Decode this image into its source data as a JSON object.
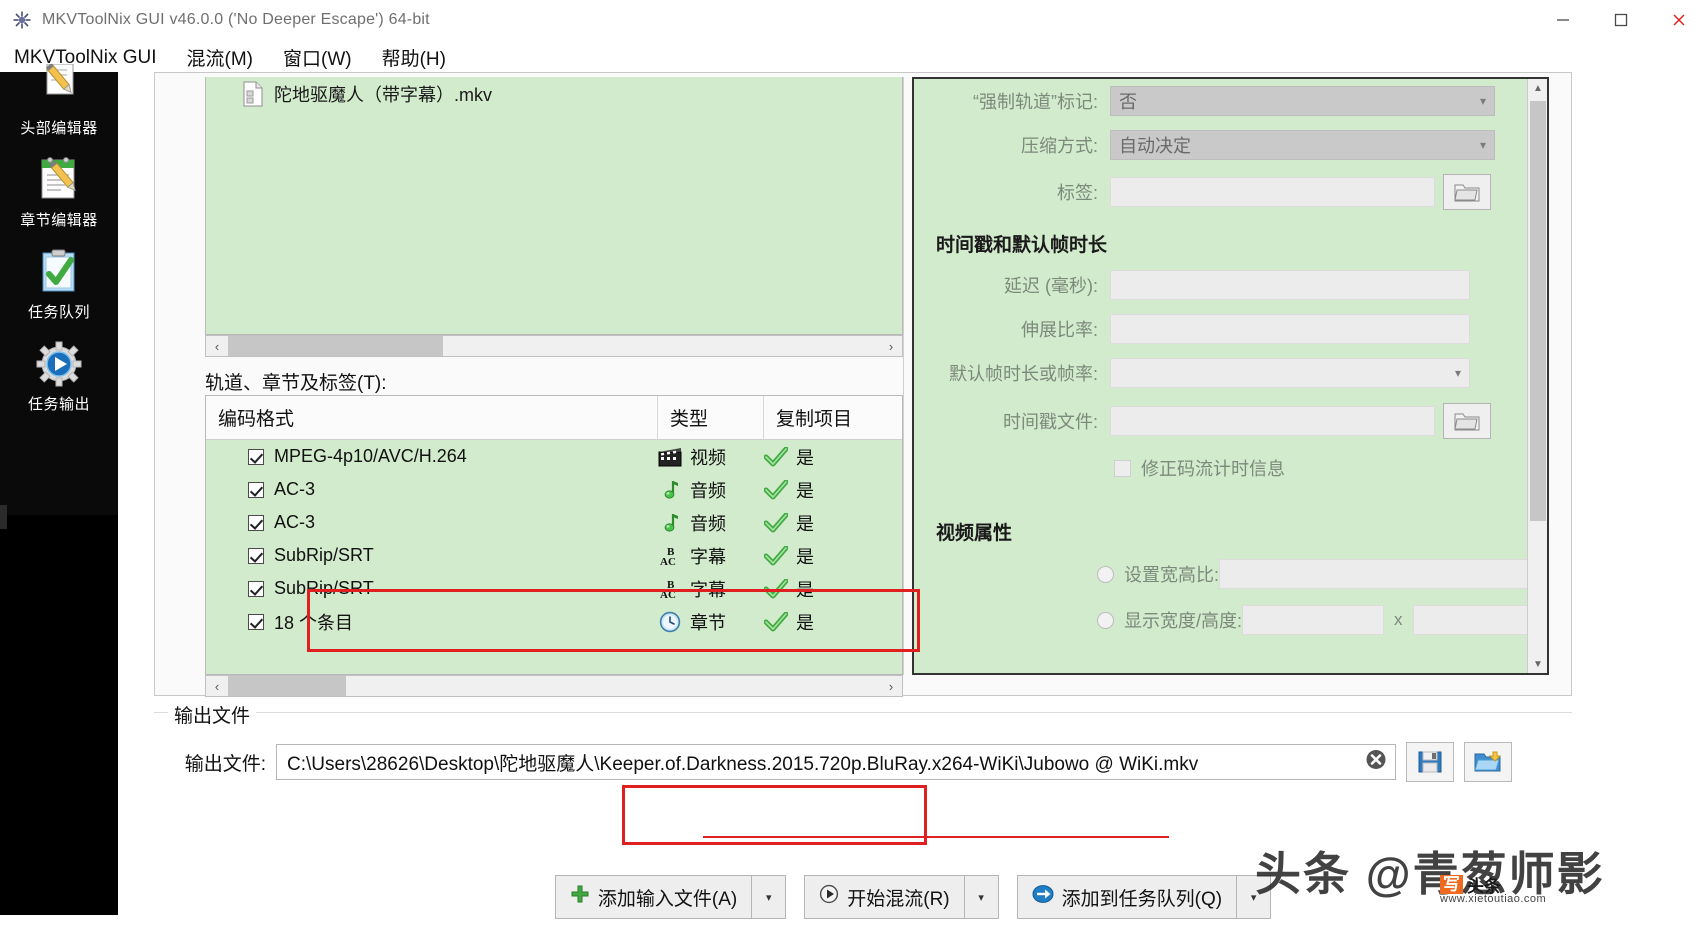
{
  "window": {
    "title": "MKVToolNix GUI v46.0.0 ('No Deeper Escape') 64-bit",
    "app_icon": "mkvtoolnix-icon",
    "minimize_label": "—",
    "maximize_label": "❐",
    "close_label": "✕"
  },
  "menubar": {
    "items": [
      {
        "label": "MKVToolNix GUI",
        "name": "menu-mkvtoolnix-gui"
      },
      {
        "label": "混流(M)",
        "name": "menu-multiplex"
      },
      {
        "label": "窗口(W)",
        "name": "menu-window"
      },
      {
        "label": "帮助(H)",
        "name": "menu-help"
      }
    ]
  },
  "sidebar": {
    "items": [
      {
        "label": "头部编辑器",
        "icon": "header-editor-icon"
      },
      {
        "label": "章节编辑器",
        "icon": "chapter-editor-icon"
      },
      {
        "label": "任务队列",
        "icon": "job-queue-icon"
      },
      {
        "label": "任务输出",
        "icon": "job-output-icon"
      }
    ]
  },
  "files": {
    "rows": [
      {
        "icon": "mkv-file-icon",
        "name": "陀地驱魔人（带字幕）.mkv"
      }
    ],
    "scroll_left_arrow": "‹",
    "scroll_right_arrow": "›"
  },
  "tracks": {
    "label": "轨道、章节及标签(T):",
    "label_accel": "T",
    "columns": [
      "编码格式",
      "类型",
      "复制项目"
    ],
    "rows": [
      {
        "checked": true,
        "codec": "MPEG-4p10/AVC/H.264",
        "type_icon": "video-icon",
        "type": "视频",
        "copy_icon": "green-check-icon",
        "copy": "是",
        "highlight": false
      },
      {
        "checked": true,
        "codec": "AC-3",
        "type_icon": "audio-icon",
        "type": "音频",
        "copy_icon": "green-check-icon",
        "copy": "是",
        "highlight": false
      },
      {
        "checked": true,
        "codec": "AC-3",
        "type_icon": "audio-icon",
        "type": "音频",
        "copy_icon": "green-check-icon",
        "copy": "是",
        "highlight": false
      },
      {
        "checked": true,
        "codec": "SubRip/SRT",
        "type_icon": "subtitle-icon",
        "type": "字幕",
        "copy_icon": "green-check-icon",
        "copy": "是",
        "highlight": true
      },
      {
        "checked": true,
        "codec": "SubRip/SRT",
        "type_icon": "subtitle-icon",
        "type": "字幕",
        "copy_icon": "green-check-icon",
        "copy": "是",
        "highlight": true
      },
      {
        "checked": true,
        "codec": "18 个条目",
        "type_icon": "chapter-icon",
        "type": "章节",
        "copy_icon": "green-check-icon",
        "copy": "是",
        "highlight": false
      }
    ],
    "scroll_left_arrow": "‹",
    "scroll_right_arrow": "›"
  },
  "properties": {
    "forced_flag": {
      "label": "“强制轨道”标记:",
      "value": "否"
    },
    "compression": {
      "label": "压缩方式:",
      "value": "自动决定"
    },
    "tags": {
      "label": "标签:",
      "value": "",
      "browse_icon": "folder-browse-icon"
    },
    "section_timestamps": "时间戳和默认帧时长",
    "delay": {
      "label": "延迟 (毫秒):",
      "value": ""
    },
    "stretch": {
      "label": "伸展比率:",
      "value": ""
    },
    "default_duration": {
      "label": "默认帧时长或帧率:",
      "value": ""
    },
    "timestamp_file": {
      "label": "时间戳文件:",
      "value": "",
      "browse_icon": "folder-browse-icon"
    },
    "fix_bitstream": {
      "label": "修正码流计时信息",
      "checked": false
    },
    "section_video": "视频属性",
    "aspect_ratio": {
      "label": "设置宽高比:",
      "selected": false,
      "value": ""
    },
    "display_wh": {
      "label": "显示宽度/高度:",
      "selected": false,
      "width": "",
      "height": "",
      "separator": "x"
    },
    "scroll_up_arrow": "▲",
    "scroll_down_arrow": "▼"
  },
  "output": {
    "legend": "输出文件",
    "label": "输出文件:",
    "path": "C:\\Users\\28626\\Desktop\\陀地驱魔人\\Keeper.of.Darkness.2015.720p.BluRay.x264-WiKi\\Jubowo @ WiKi.mkv",
    "clear_icon": "clear-circle-icon",
    "save_icon": "save-icon",
    "browse_icon": "folder-open-icon"
  },
  "actions": {
    "add_files": {
      "label": "添加输入文件(A)",
      "icon": "plus-green-icon",
      "dropdown": "▾"
    },
    "start_mux": {
      "label": "开始混流(R)",
      "icon": "play-circle-icon",
      "dropdown": "▾",
      "highlighted": true
    },
    "add_to_queue": {
      "label": "添加到任务队列(Q)",
      "icon": "blue-arrow-icon",
      "dropdown": "▾"
    }
  },
  "annotations": {
    "highlight_color": "#e02020",
    "regions": [
      "subtitle-track-rows",
      "start-multiplex-button"
    ]
  },
  "watermark": {
    "text": "头条 @青葱师影",
    "badge_char": "写",
    "badge_text": "头条",
    "url": "www.xietoutiao.com"
  }
}
